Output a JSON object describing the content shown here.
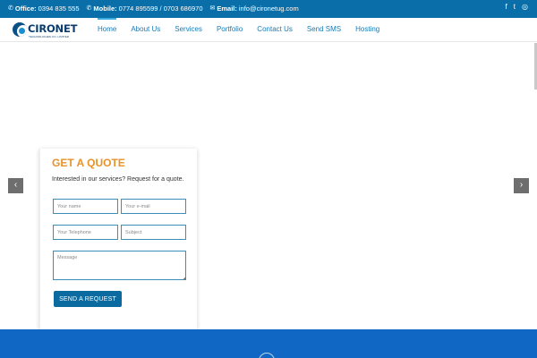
{
  "topbar": {
    "office_label": "Office:",
    "office_value": "0394 835 555",
    "mobile_label": "Mobile:",
    "mobile_value": "0774 895599 / 0703 686970",
    "email_label": "Email:",
    "email_value": "info@cironetug.com",
    "phone_icon": "phone-icon",
    "mail_icon": "envelope-icon",
    "social": [
      "facebook-icon",
      "twitter-icon",
      "instagram-icon"
    ]
  },
  "logo": {
    "name": "CIRONET",
    "tagline": "TECHNOLOGIES CO. LIMITED"
  },
  "nav": {
    "items": [
      "Home",
      "About Us",
      "Services",
      "Portfolio",
      "Contact Us",
      "Send SMS",
      "Hosting"
    ],
    "active": "Home"
  },
  "quote": {
    "title": "GET A QUOTE",
    "text": "Interested in our services? Request for a quote.",
    "name_placeholder": "Your name",
    "email_placeholder": "Your e-mail",
    "tel_placeholder": "Your Telephone",
    "subject_placeholder": "Subject",
    "message_placeholder": "Message",
    "submit_label": "SEND A REQUEST"
  },
  "colors": {
    "topbar": "#0a6fa8",
    "nav_text": "#1a7ab5",
    "quote_title": "#e8922a",
    "button": "#0b6aa0",
    "footer_band": "#1068c4"
  }
}
